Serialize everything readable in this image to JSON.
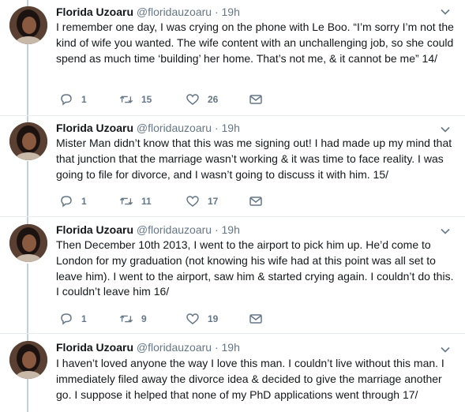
{
  "tweets": [
    {
      "name": "Florida Uzoaru",
      "handle": "@floridauzoaru",
      "separator": "·",
      "time": "19h",
      "text": "I remember one day, I was crying on the phone with Le Boo. “I’m sorry I’m not the kind of wife you wanted. The wife content with an unchallenging job, so she could spend as much time ‘building’ her home. That’s not me, & it cannot be me” 14/",
      "replies": "1",
      "retweets": "15",
      "likes": "26"
    },
    {
      "name": "Florida Uzoaru",
      "handle": "@floridauzoaru",
      "separator": "·",
      "time": "19h",
      "text": "Mister Man didn’t know that this was me signing out! I had made up my mind that that junction that the marriage wasn’t working & it was time to face reality. I was going to file for divorce, and I wasn’t going to discuss it with him. 15/",
      "replies": "1",
      "retweets": "11",
      "likes": "17"
    },
    {
      "name": "Florida Uzoaru",
      "handle": "@floridauzoaru",
      "separator": "·",
      "time": "19h",
      "text": "Then December 10th 2013, I went to the airport to pick him up. He’d come to London for my graduation (not knowing his wife had at this point was all set to leave him). I went to the airport, saw him & started crying again. I couldn’t do this. I couldn’t leave him 16/",
      "replies": "1",
      "retweets": "9",
      "likes": "19"
    },
    {
      "name": "Florida Uzoaru",
      "handle": "@floridauzoaru",
      "separator": "·",
      "time": "19h",
      "text": "I haven’t loved anyone the way I love this man. I couldn’t live without this man. I immediately filed away the divorce idea & decided to give the marriage another go. I suppose it helped that none of my PhD applications went through 17/"
    }
  ],
  "icons": {
    "reply": "reply-icon",
    "retweet": "retweet-icon",
    "like": "heart-icon",
    "message": "envelope-icon",
    "more": "chevron-down-icon"
  },
  "colors": {
    "text": "#14171a",
    "secondary": "#657786",
    "divider": "#e6ecf0",
    "thread_line": "#c4cfd6"
  }
}
